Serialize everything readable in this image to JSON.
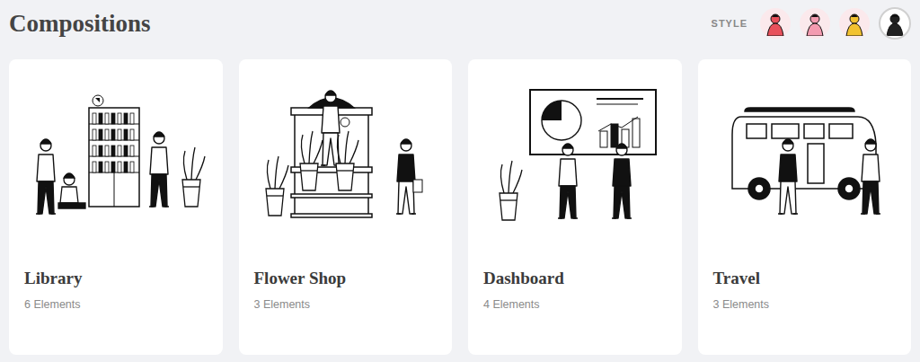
{
  "title": "Compositions",
  "style": {
    "label": "STYLE",
    "options": [
      {
        "selected": false,
        "color": "#e8505b"
      },
      {
        "selected": false,
        "color": "#f39bb0"
      },
      {
        "selected": false,
        "color": "#f2c230"
      },
      {
        "selected": true,
        "color": "#222222"
      }
    ]
  },
  "cards": [
    {
      "title": "Library",
      "count": "6 Elements",
      "kind": "library"
    },
    {
      "title": "Flower Shop",
      "count": "3 Elements",
      "kind": "shop"
    },
    {
      "title": "Dashboard",
      "count": "4 Elements",
      "kind": "dashboard"
    },
    {
      "title": "Travel",
      "count": "3 Elements",
      "kind": "travel"
    }
  ]
}
